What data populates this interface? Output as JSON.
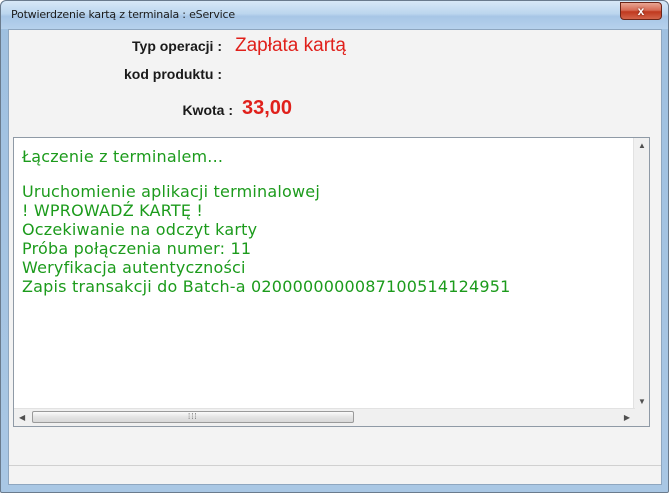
{
  "window": {
    "title": "Potwierdzenie kartą z terminala : eService",
    "close_label": "x"
  },
  "form": {
    "operation_type_label": "Typ operacji :",
    "operation_type_value": "Zapłata kartą",
    "product_code_label": "kod produktu :",
    "product_code_value": "",
    "amount_label": "Kwota :",
    "amount_value": "33,00"
  },
  "log": {
    "lines": [
      "Łączenie z terminalem...",
      "",
      "Uruchomienie aplikacji terminalowej",
      "! WPROWADŹ KARTĘ !",
      "Oczekiwanie na odczyt karty",
      "Próba połączenia numer: 11",
      "Weryfikacja autentyczności",
      "Zapis transakcji do Batch-a 0200000000087100514124951"
    ]
  },
  "colors": {
    "accent_red": "#e0201b",
    "log_green": "#1c9b1c"
  }
}
